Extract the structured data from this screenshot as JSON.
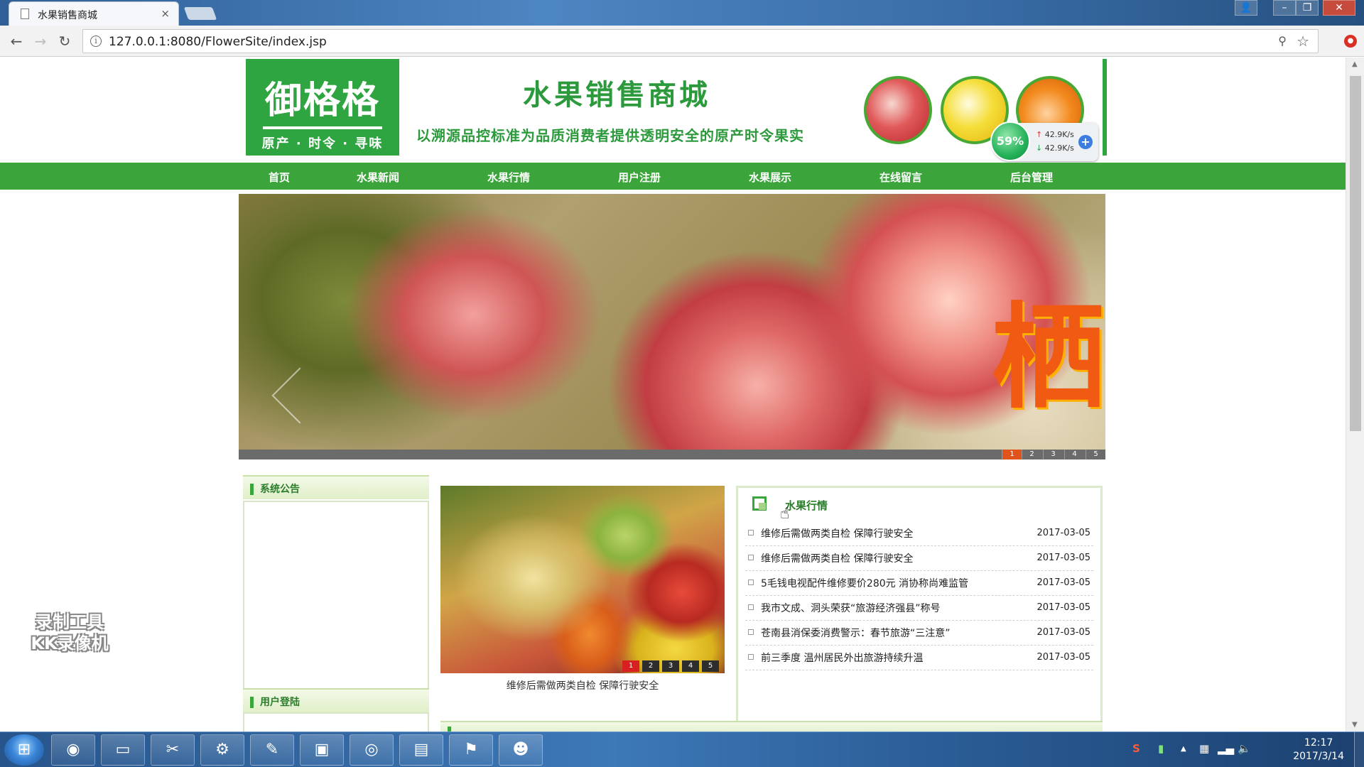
{
  "browser": {
    "tab_title": "水果销售商城",
    "tab_close": "×",
    "url": "127.0.0.1:8080/FlowerSite/index.jsp",
    "back": "←",
    "forward": "→",
    "reload": "↻",
    "info": "i",
    "key_icon": "⚲",
    "star": "☆",
    "extension_badge": "●",
    "window_controls": {
      "user": "👤",
      "minimize": "–",
      "restore": "❐",
      "close": "✕"
    }
  },
  "header": {
    "logo_main": "御格格",
    "logo_sub": "原产 · 时令 · 寻味",
    "site_title": "水果销售商城",
    "slogan": "以溯源品控标准为品质消费者提供透明安全的原产时令果实"
  },
  "speed_widget": {
    "percent": "59%",
    "upload_arrow": "↑",
    "upload": "42.9K/s",
    "download_arrow": "↓",
    "download": "42.9K/s",
    "plus": "+"
  },
  "nav": [
    {
      "label": "首页"
    },
    {
      "label": "水果新闻"
    },
    {
      "label": "水果行情"
    },
    {
      "label": "用户注册"
    },
    {
      "label": "水果展示"
    },
    {
      "label": "在线留言"
    },
    {
      "label": "后台管理"
    }
  ],
  "banner": {
    "char": "栖",
    "pager": [
      "1",
      "2",
      "3",
      "4",
      "5"
    ],
    "active_page": "1"
  },
  "sidebar": {
    "notice_title": "系统公告",
    "login_title": "用户登陆"
  },
  "news_slider": {
    "pager": [
      "1",
      "2",
      "3",
      "4",
      "5"
    ],
    "active_page": "1",
    "caption": "维修后需做两类自检 保障行驶安全"
  },
  "market": {
    "title": "水果行情",
    "items": [
      {
        "title": "维修后需做两类自检 保障行驶安全",
        "date": "2017-03-05"
      },
      {
        "title": "维修后需做两类自检 保障行驶安全",
        "date": "2017-03-05"
      },
      {
        "title": "5毛钱电视配件维修要价280元 消协称尚难监管",
        "date": "2017-03-05"
      },
      {
        "title": "我市文成、洞头荣获“旅游经济强县”称号",
        "date": "2017-03-05"
      },
      {
        "title": "苍南县消保委消费警示：春节旅游“三注意”",
        "date": "2017-03-05"
      },
      {
        "title": "前三季度 温州居民外出旅游持续升温",
        "date": "2017-03-05"
      }
    ]
  },
  "watermark": {
    "line1": "录制工具",
    "line2": "KK录像机"
  },
  "taskbar": {
    "start": "⊞",
    "apps": [
      {
        "name": "chrome",
        "glyph": "◉"
      },
      {
        "name": "explorer",
        "glyph": "▭"
      },
      {
        "name": "tools",
        "glyph": "✂"
      },
      {
        "name": "settings",
        "glyph": "⚙"
      },
      {
        "name": "editor",
        "glyph": "✎"
      },
      {
        "name": "toolbox",
        "glyph": "▣"
      },
      {
        "name": "netease-music",
        "glyph": "◎"
      },
      {
        "name": "remote",
        "glyph": "▤"
      },
      {
        "name": "flag",
        "glyph": "⚑"
      },
      {
        "name": "recorder",
        "glyph": "☻"
      }
    ],
    "tray": {
      "ime": "S",
      "battery": "▮",
      "expand": "▲",
      "network": "▦",
      "signal": "▂▄",
      "volume": "🔈"
    },
    "time": "12:17",
    "date": "2017/3/14"
  }
}
